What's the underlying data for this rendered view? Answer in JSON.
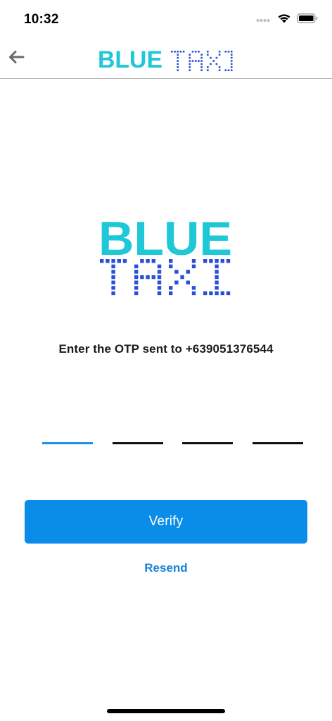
{
  "status_bar": {
    "time": "10:32"
  },
  "nav": {
    "brand_solid": "BLUE",
    "brand_dotted": "TAXI"
  },
  "logo": {
    "top_word": "BLUE",
    "bottom_word": "TAXI"
  },
  "prompt": {
    "text": "Enter the OTP sent to +639051376544"
  },
  "otp": {
    "digits": [
      "",
      "",
      "",
      ""
    ]
  },
  "actions": {
    "verify_label": "Verify",
    "resend_label": "Resend"
  },
  "colors": {
    "cyan": "#1fc8d6",
    "dark_blue": "#2a4fd6",
    "accent": "#0a8ce9",
    "link": "#1582d8",
    "active_field": "#1f8ee8"
  },
  "icons": {
    "back": "arrow-left-icon",
    "signal": "signal-dots-icon",
    "wifi": "wifi-icon",
    "battery": "battery-icon"
  }
}
